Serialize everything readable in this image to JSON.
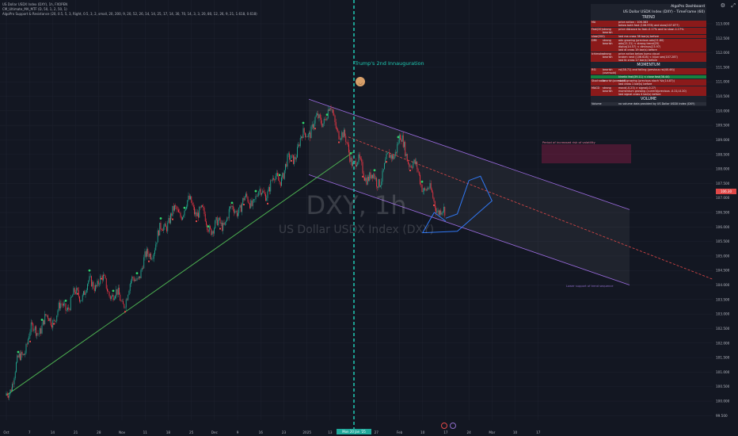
{
  "header": {
    "symbol_line": "US Dollar USDX Index (DXY), 1h, FXOPEN",
    "indicator_1": "CM_Ultimate_MA_MTF (D, 50, 1, 2, 50, 1)",
    "indicator_2": "AlgoPro Support & Resistance (20, 0.5, 5, 3, Right, 0.5, 3, 2, small, 20, 200, 9, 20, 52, 26, 14, 14, 25, 17, 14, 30, 70, 14, 3, 3, 20, 80, 12, 26, 9, 21, 1.618, 0.618)"
  },
  "watermark": {
    "ticker": "DXY, 1h",
    "name": "US Dollar USDX Index (DXY)"
  },
  "annotations": {
    "event_label": "Trump's 2nd Innauguration",
    "volatility_label": "Period of increased risk of volatility",
    "lower_note": "Lower support of trend sequence"
  },
  "price_tag": "106.30",
  "date_tag": "Mon 20 Jan '25",
  "dashboard": {
    "title": "AlgoPro Dashboard",
    "subtitle": "US Dollar USDX Index (DXY) - TimeFrame (60)",
    "sections": [
      {
        "name": "TREND",
        "rows": [
          {
            "c1": "MA",
            "c2": "",
            "c3": "price action : 106.383\nbelow both fast (106.978) and slow(107.877)",
            "color": "red"
          },
          {
            "c1": "Fast(20)",
            "c2": "strong bearish",
            "c3": "price distance to fast:-0.17% and to slow:-1.17%",
            "color": "red"
          },
          {
            "c1": "slow(200)",
            "c2": "",
            "c3": "last ma cross 38 bar(s) before",
            "color": "red"
          },
          {
            "c1": "DMI",
            "c2": "strong bearish",
            "c3": "adx growing (previous adx(21.80)\nadx(21.31) < strong trend(25)\ndiplus(14.57) < diminus(23.97)\nlast di cross 19 bar(s) before",
            "color": "red"
          },
          {
            "c1": "Ichimoku",
            "c2": "strong bearish",
            "c3": "price action below kumo cloud\nbroken next (106.628) < kijun sen(107.287)\nlast tk cross 17 bar(s) before",
            "color": "red"
          }
        ]
      },
      {
        "name": "MOMENTUM",
        "rows": [
          {
            "c1": "RSI",
            "c2": "bearish (oversold)",
            "c3": "rsi(38.71) and falling (previous rsi(40.46))",
            "color": "red"
          },
          {
            "c1": "",
            "c2": "",
            "c3": "kinetic fast(39.11) < close fast(38.44)",
            "color": "green"
          },
          {
            "c1": "Stochastic",
            "c2": "bearish(oversold)",
            "c3": "stoch growing  (previous stoch %k(14.87))\nlast cross 1 bar(s) before",
            "color": "red"
          },
          {
            "c1": "MACD",
            "c2": "strong bearish",
            "c3": "macd(-0.23) > signal(-0.27)\nmomentum growing (current(previous -0.21/-0.20)\nlast signal cross 4 bar(s) before",
            "color": "red"
          }
        ]
      },
      {
        "name": "VOLUME",
        "rows": [
          {
            "c1": "Volume",
            "c2": "",
            "c3": "no volume data provided by US Dollar USDX Index (DXY)",
            "color": "grey"
          }
        ]
      }
    ]
  },
  "colors": {
    "background": "#131722",
    "grid": "#1f2330",
    "candle_up": "#22ab94",
    "candle_down": "#f23645",
    "trendline": "#4caf50",
    "channel": "#9c6ce0",
    "projection": "#3179f5",
    "event_line": "#1ecbb4",
    "midline": "#e04848"
  },
  "chart_data": {
    "type": "line",
    "title": "US Dollar USDX Index (DXY), 1h",
    "ylim": [
      99.4,
      113.6
    ],
    "y_ticks": [
      "113.000",
      "112.500",
      "112.000",
      "111.500",
      "111.000",
      "110.500",
      "110.000",
      "109.500",
      "109.000",
      "108.500",
      "108.000",
      "107.500",
      "107.000",
      "106.500",
      "106.000",
      "105.500",
      "105.000",
      "104.500",
      "104.000",
      "103.500",
      "103.000",
      "102.500",
      "102.000",
      "101.500",
      "101.000",
      "100.500",
      "100.000",
      "99.500"
    ],
    "x_ticks": [
      "Oct",
      "7",
      "14",
      "21",
      "28",
      "Nov",
      "11",
      "18",
      "25",
      "Dec",
      "9",
      "16",
      "23",
      "2025",
      "13",
      "20",
      "27",
      "Feb",
      "10",
      "17",
      "24",
      "Mar",
      "10",
      "17"
    ],
    "series": [
      {
        "name": "DXY",
        "x": [
          "Oct",
          "7",
          "14",
          "21",
          "28",
          "Nov",
          "11",
          "18",
          "25",
          "Dec",
          "9",
          "16",
          "23",
          "2025",
          "13",
          "20",
          "27",
          "Feb",
          "10",
          "17"
        ],
        "values": [
          100.2,
          102.3,
          102.9,
          103.6,
          104.2,
          103.4,
          104.8,
          106.3,
          106.8,
          105.9,
          106.7,
          107.1,
          107.9,
          109.3,
          110.0,
          108.3,
          107.5,
          109.0,
          107.5,
          106.3
        ]
      },
      {
        "name": "Projection",
        "x": [
          "17",
          "24",
          "Mar",
          "10",
          "17"
        ],
        "values": [
          106.3,
          107.6,
          106.9,
          105.8,
          106.2
        ]
      }
    ]
  }
}
